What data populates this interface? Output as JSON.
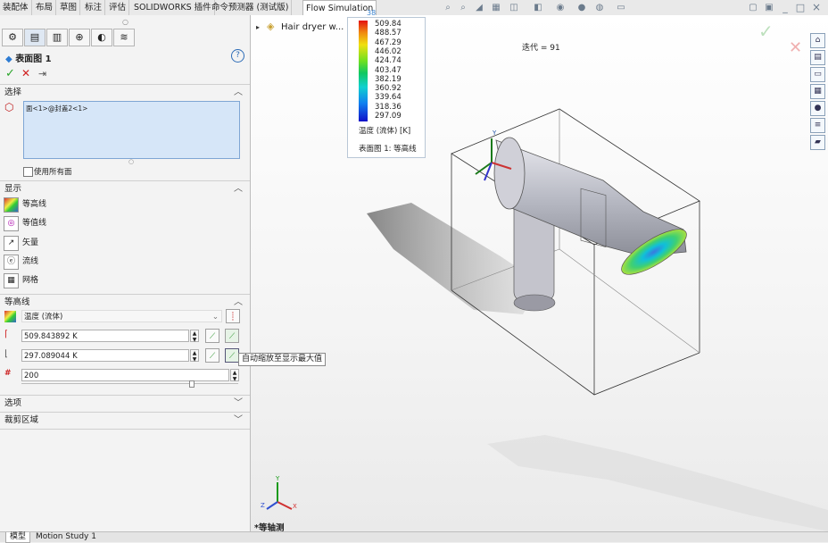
{
  "toolbar_tabs": [
    "装配体",
    "布局",
    "草图",
    "标注",
    "评估",
    "SOLIDWORKS 插件",
    "命令预测器 (测试版)",
    "Flow Simulation"
  ],
  "window_controls": {
    "minimize": "_",
    "restore": "□",
    "close": "×"
  },
  "panel": {
    "title": "表面图 1",
    "help": "?",
    "sections": {
      "selection": {
        "label": "选择",
        "item": "面<1>@封盖2<1>",
        "use_all_faces": "使用所有面"
      },
      "display": {
        "label": "显示",
        "items": [
          "等高线",
          "等值线",
          "矢量",
          "流线",
          "网格"
        ]
      },
      "contours": {
        "label": "等高线",
        "parameter": "温度 (流体)",
        "max_value": "509.843892 K",
        "min_value": "297.089044 K",
        "levels": "200"
      },
      "options": {
        "label": "选项"
      },
      "clip": {
        "label": "裁剪区域"
      }
    },
    "tooltip": "自动缩放至显示最大值"
  },
  "viewport": {
    "tree_item": "Hair dryer w...",
    "iteration_label": "迭代 = 91",
    "view_label": "*等轴测",
    "legend": {
      "values": [
        "509.84",
        "488.57",
        "467.29",
        "446.02",
        "424.74",
        "403.47",
        "382.19",
        "360.92",
        "339.64",
        "318.36",
        "297.09"
      ],
      "title": "温度 (流体) [K]",
      "subtitle": "表面图 1: 等高线",
      "stray": "38"
    },
    "triad": {
      "x": "X",
      "y": "Y",
      "z": "Z"
    }
  },
  "bottom_tabs": [
    "模型",
    "Motion Study 1"
  ],
  "colors": {
    "accent": "#1e6fc0",
    "ok": "#2aa52a",
    "cancel": "#d02020",
    "selection": "#d6e6f8"
  }
}
